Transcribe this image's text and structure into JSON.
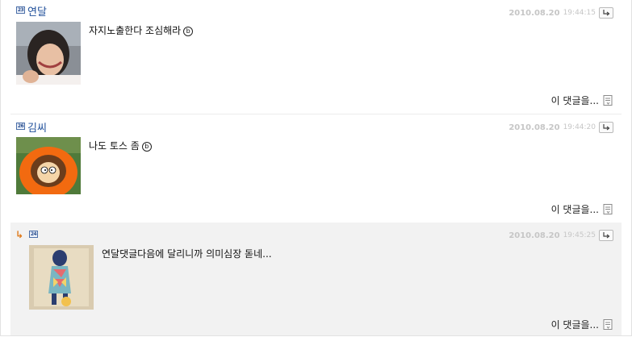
{
  "comments": [
    {
      "level": "23",
      "author": "연달",
      "date": "2010.08.20",
      "time": "19:44:15",
      "text": "자지노출한다 조심해라",
      "emoticon": "ⓑ",
      "more_label": "이 댓글을..."
    },
    {
      "level": "26",
      "author": "김씨",
      "date": "2010.08.20",
      "time": "19:44:20",
      "text": "나도 토스 좀",
      "emoticon": "ⓑ",
      "more_label": "이 댓글을..."
    }
  ],
  "reply": {
    "arrow": "↳",
    "level": "24",
    "author": "",
    "date": "2010.08.20",
    "time": "19:45:25",
    "text": "연달댓글다음에 달리니까 의미심장 돋네...",
    "more_label": "이 댓글을..."
  },
  "colors": {
    "author": "#1f4f9a",
    "reply_arrow": "#e07a1a",
    "reply_bg": "#f2f2f2",
    "date": "#c6c6c6"
  },
  "icons": {
    "reply_button": "reply-arrow-icon",
    "more": "document-icon"
  }
}
